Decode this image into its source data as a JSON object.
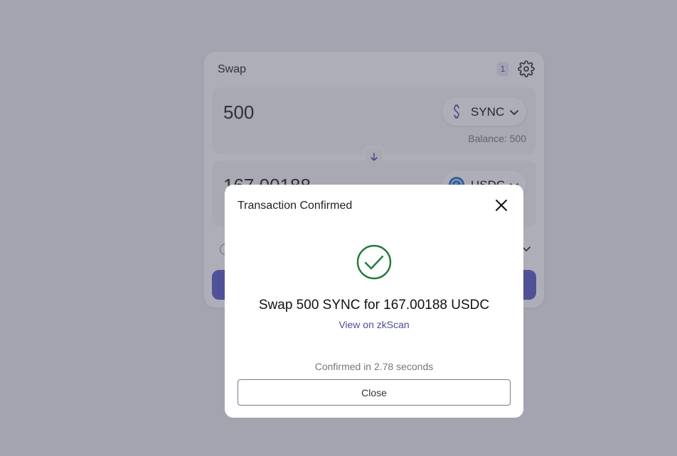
{
  "swap": {
    "title": "Swap",
    "badge": "1",
    "from": {
      "amount": "500",
      "token": "SYNC",
      "token_icon": "sync-token-icon",
      "balance": "Balance: 500"
    },
    "to": {
      "amount": "167.00188",
      "token": "USDC",
      "token_icon": "usdc-token-icon"
    }
  },
  "modal": {
    "title": "Transaction Confirmed",
    "message": "Swap 500 SYNC for 167.00188 USDC",
    "link": "View on zkScan",
    "confirmed": "Confirmed in 2.78 seconds",
    "close_label": "Close"
  },
  "colors": {
    "accent": "#5a5bc6",
    "success": "#1e7a3c",
    "link": "#4e4e8e"
  }
}
